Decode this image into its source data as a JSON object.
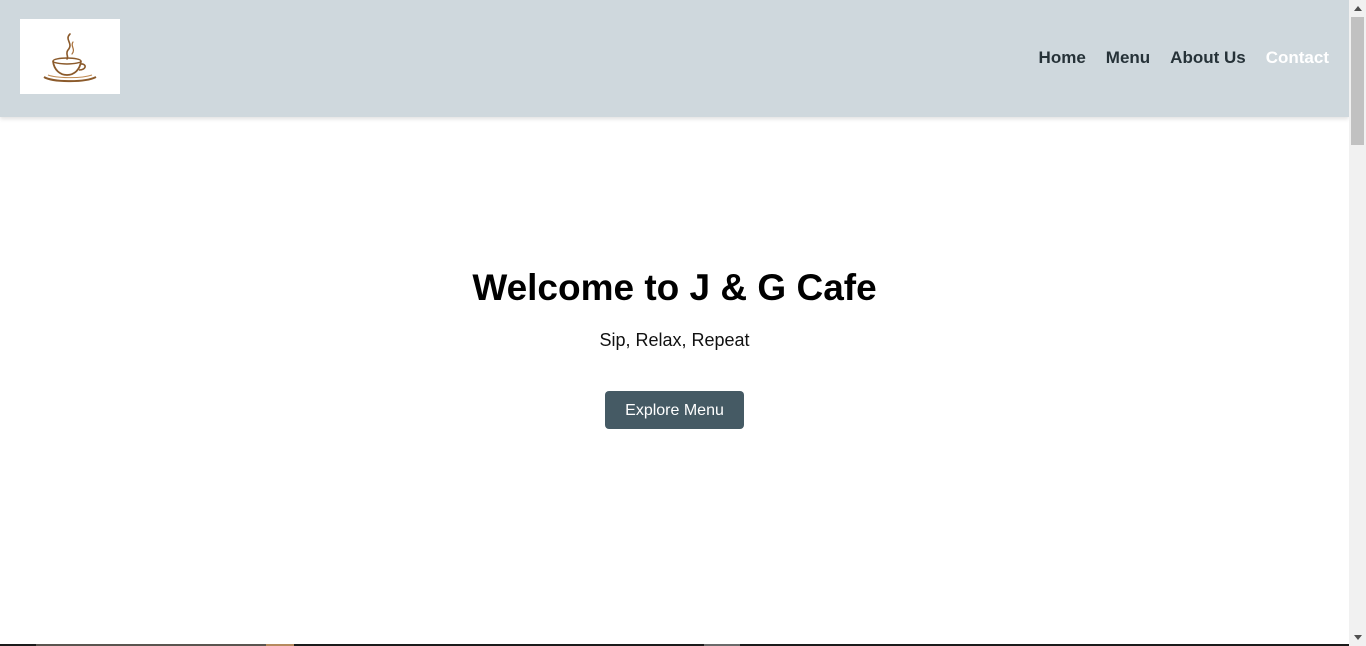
{
  "header": {
    "logo_icon": "coffee-cup-icon",
    "nav": [
      {
        "label": "Home",
        "active": false
      },
      {
        "label": "Menu",
        "active": false
      },
      {
        "label": "About Us",
        "active": false
      },
      {
        "label": "Contact",
        "active": true
      }
    ]
  },
  "hero": {
    "title": "Welcome to J & G Cafe",
    "subtitle": "Sip, Relax, Repeat",
    "cta_label": "Explore Menu"
  },
  "colors": {
    "header_bg": "#cfd8dd",
    "nav_text": "#263238",
    "nav_active": "#ffffff",
    "button_bg": "#455a64",
    "coffee_brown": "#8b5a2b"
  },
  "icons": {
    "scroll_up": "chevron-up-icon",
    "scroll_down": "chevron-down-icon"
  }
}
